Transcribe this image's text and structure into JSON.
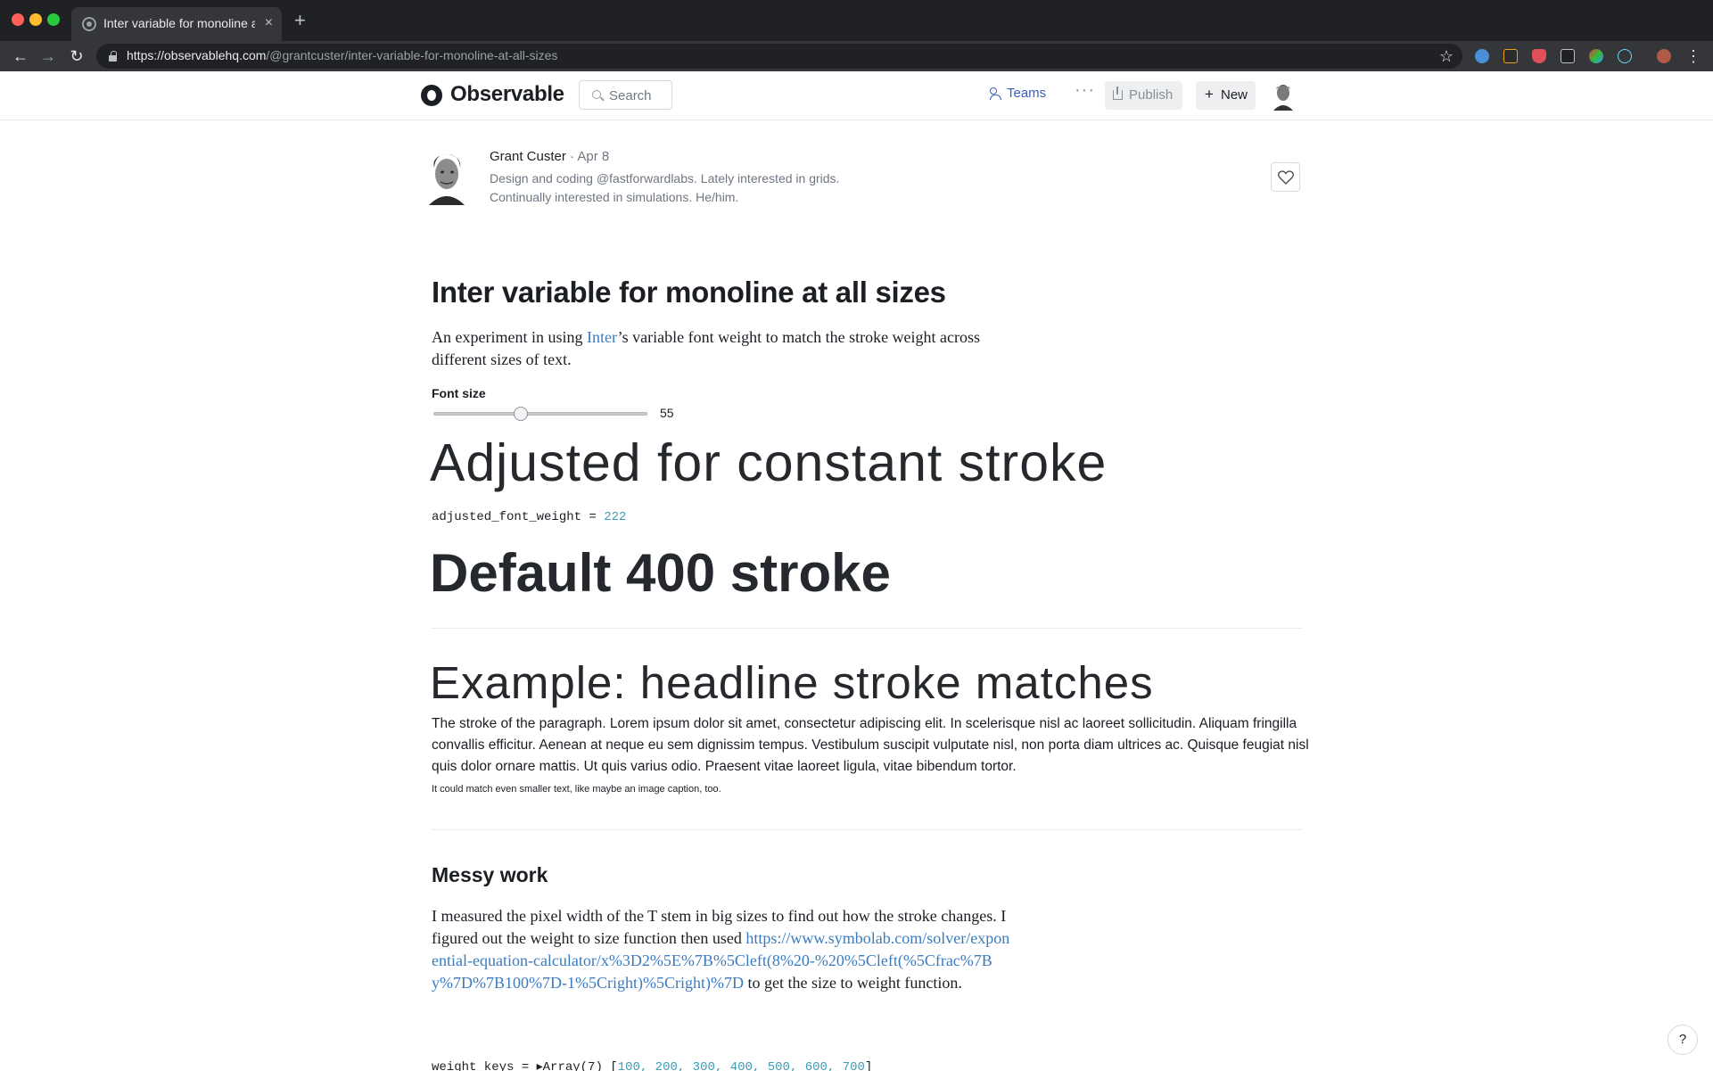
{
  "browser": {
    "tab_title": "Inter variable for monoline at all sizes",
    "url_host": "https://observablehq.com",
    "url_path": "/@grantcuster/inter-variable-for-monoline-at-all-sizes"
  },
  "header": {
    "logo": "Observable",
    "search_placeholder": "Search",
    "teams_label": "Teams",
    "more_label": "···",
    "publish_label": "Publish",
    "new_label": "New"
  },
  "author": {
    "name": "Grant Custer",
    "date": " · Apr 8",
    "bio_line1": "Design and coding @fastforwardlabs. Lately interested in grids.",
    "bio_line2": "Continually interested in simulations. He/him."
  },
  "notebook": {
    "title": "Inter variable for monoline at all sizes",
    "intro_before": "An experiment in using ",
    "intro_link": "Inter",
    "intro_after": "’s variable font weight to match the stroke weight across different sizes of text.",
    "slider_label": "Font size",
    "slider_value": "55",
    "slider_fraction": 0.4,
    "adjusted_heading": "Adjusted for constant stroke",
    "code_name": "adjusted_font_weight = ",
    "code_value": "222",
    "default_heading": "Default 400 stroke",
    "example_heading": "Example: headline stroke matches",
    "example_paragraph": "The stroke of the paragraph. Lorem ipsum dolor sit amet, consectetur adipiscing elit. In scelerisque nisl ac laoreet sollicitudin. Aliquam fringilla convallis efficitur. Aenean at neque eu sem dignissim tempus. Vestibulum suscipit vulputate nisl, non porta diam ultrices ac. Quisque feugiat nisl quis dolor ornare mattis. Ut quis varius odio. Praesent vitae laoreet ligula, vitae bibendum tortor.",
    "example_caption": "It could match even smaller text, like maybe an image caption, too.",
    "messy_heading": "Messy work",
    "messy_before": "I measured the pixel width of the T stem in big sizes to find out how the stroke changes. I figured out the weight to size function then used ",
    "messy_link": "https://www.symbolab.com/solver/exponential-equation-calculator/x%3D2%5E%7B%5Cleft(8%20-%20%5Cleft(%5Cfrac%7By%7D%7B100%7D-1%5Cright)%5Cright)%7D",
    "messy_after": " to get the size to weight function.",
    "weights_name": "weight_keys = ",
    "weights_type": "▸Array(7) [",
    "weights_values": "100, 200, 300, 400, 500, 600, 700",
    "weights_close": "]"
  },
  "help_label": "?",
  "colors": {
    "link": "#3b7bbf",
    "number": "#3b9bb8",
    "chrome_dark": "#202124",
    "chrome_tab": "#35363a"
  }
}
